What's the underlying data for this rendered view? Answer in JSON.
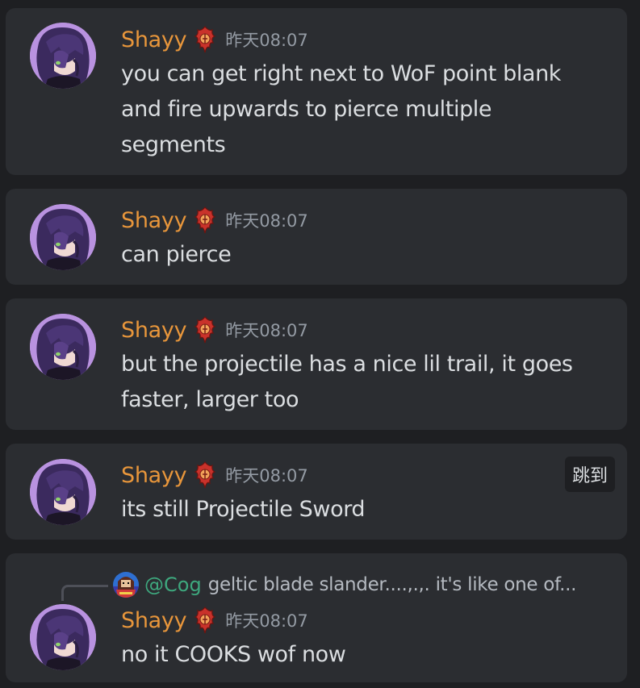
{
  "colors": {
    "background": "#1e1f22",
    "message_card": "#2b2d31",
    "username": "#e8963b",
    "timestamp": "#949ba4",
    "text": "#dbdee1",
    "mention": "#3ea87e"
  },
  "messages": [
    {
      "username": "Shayy",
      "badge_icon": "flame-badge-icon",
      "timestamp": "昨天08:07",
      "lines": [
        "you can get right next to WoF point blank",
        "and fire upwards to pierce multiple",
        "segments"
      ]
    },
    {
      "username": "Shayy",
      "badge_icon": "flame-badge-icon",
      "timestamp": "昨天08:07",
      "lines": [
        "can pierce"
      ]
    },
    {
      "username": "Shayy",
      "badge_icon": "flame-badge-icon",
      "timestamp": "昨天08:07",
      "lines": [
        "but the projectile has a nice lil trail, it goes",
        "faster, larger too"
      ]
    },
    {
      "username": "Shayy",
      "badge_icon": "flame-badge-icon",
      "timestamp": "昨天08:07",
      "lines": [
        "its still Projectile Sword"
      ],
      "jump_label": "跳到"
    },
    {
      "username": "Shayy",
      "badge_icon": "flame-badge-icon",
      "timestamp": "昨天08:07",
      "lines": [
        "no it COOKS wof now"
      ],
      "reply": {
        "mention": "@Cog",
        "preview": "geltic blade slander....,.,. it's like one of..."
      }
    }
  ]
}
